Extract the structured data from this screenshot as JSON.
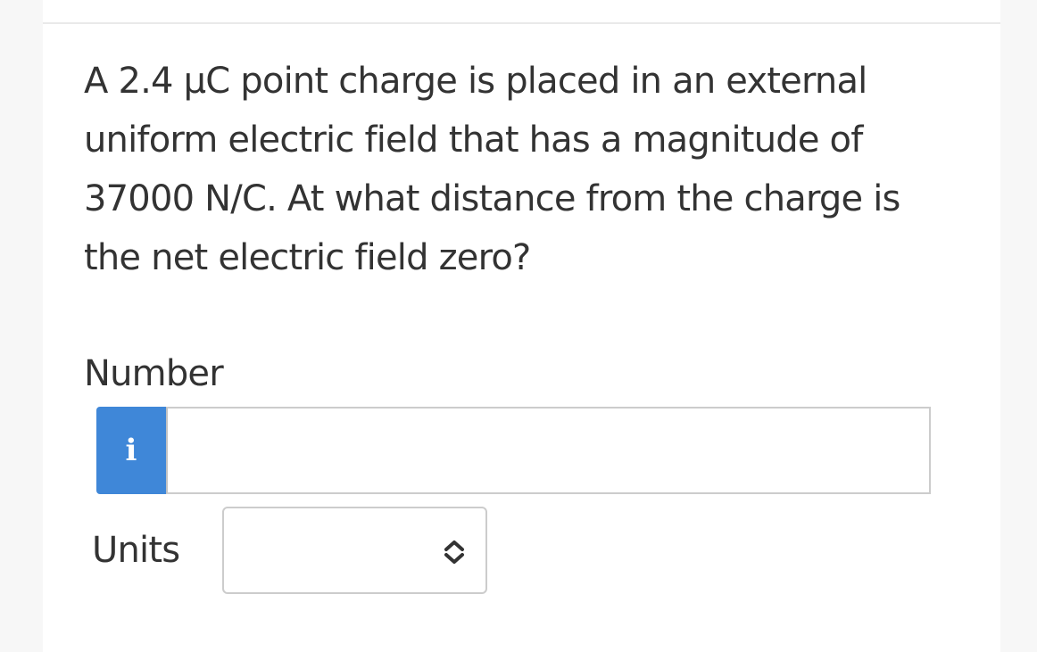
{
  "question": {
    "text": "A 2.4 μC point charge is placed in an external uniform electric field that has a magnitude of 37000 N/C. At what distance from the charge is the net electric field zero?"
  },
  "number_field": {
    "label": "Number",
    "info_button": "i",
    "value": ""
  },
  "units_field": {
    "label": "Units",
    "selected": ""
  },
  "colors": {
    "info_button": "#3f87d8",
    "border": "#cccccc",
    "text": "#333333"
  },
  "icons": {
    "info_button": "info-icon",
    "units_select": "chevron-up-down-icon"
  }
}
